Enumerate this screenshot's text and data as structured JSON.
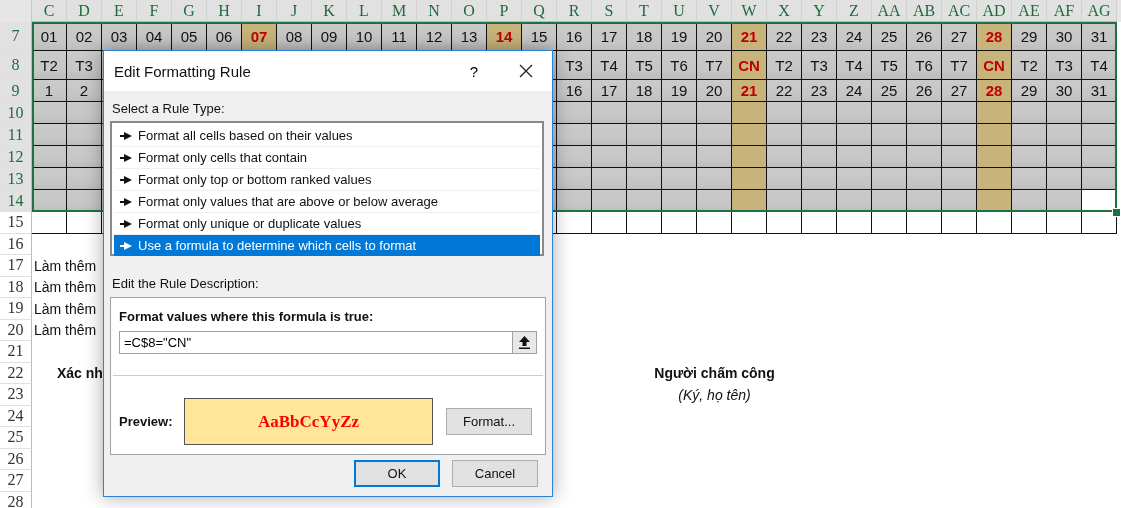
{
  "grid": {
    "columns": [
      {
        "label": "C",
        "selected": true
      },
      {
        "label": "D",
        "selected": true
      },
      {
        "label": "E",
        "selected": true
      },
      {
        "label": "F",
        "selected": true
      },
      {
        "label": "G",
        "selected": true
      },
      {
        "label": "H",
        "selected": true
      },
      {
        "label": "I",
        "selected": true
      },
      {
        "label": "J",
        "selected": true
      },
      {
        "label": "K",
        "selected": true
      },
      {
        "label": "L",
        "selected": true
      },
      {
        "label": "M",
        "selected": true
      },
      {
        "label": "N",
        "selected": true
      },
      {
        "label": "O",
        "selected": true
      },
      {
        "label": "P",
        "selected": true
      },
      {
        "label": "Q",
        "selected": true
      },
      {
        "label": "R",
        "selected": true
      },
      {
        "label": "S",
        "selected": true
      },
      {
        "label": "T",
        "selected": true
      },
      {
        "label": "U",
        "selected": true
      },
      {
        "label": "V",
        "selected": true
      },
      {
        "label": "W",
        "selected": true
      },
      {
        "label": "X",
        "selected": true
      },
      {
        "label": "Y",
        "selected": true
      },
      {
        "label": "Z",
        "selected": true
      },
      {
        "label": "AA",
        "selected": true
      },
      {
        "label": "AB",
        "selected": true
      },
      {
        "label": "AC",
        "selected": true
      },
      {
        "label": "AD",
        "selected": true
      },
      {
        "label": "AE",
        "selected": true
      },
      {
        "label": "AF",
        "selected": true
      },
      {
        "label": "AG",
        "selected": true
      }
    ],
    "rows": [
      {
        "header": "7",
        "selected": true,
        "kind": "full",
        "cells": [
          {
            "text": "01",
            "kind": "weekday"
          },
          {
            "text": "02",
            "kind": "weekday"
          },
          {
            "text": "03",
            "kind": "weekday"
          },
          {
            "text": "04",
            "kind": "weekday"
          },
          {
            "text": "05",
            "kind": "weekday"
          },
          {
            "text": "06",
            "kind": "weekday"
          },
          {
            "text": "07",
            "kind": "sunday"
          },
          {
            "text": "08",
            "kind": "weekday"
          },
          {
            "text": "09",
            "kind": "weekday"
          },
          {
            "text": "10",
            "kind": "weekday"
          },
          {
            "text": "11",
            "kind": "weekday"
          },
          {
            "text": "12",
            "kind": "weekday"
          },
          {
            "text": "13",
            "kind": "weekday"
          },
          {
            "text": "14",
            "kind": "sunday"
          },
          {
            "text": "15",
            "kind": "weekday"
          },
          {
            "text": "16",
            "kind": "weekday"
          },
          {
            "text": "17",
            "kind": "weekday"
          },
          {
            "text": "18",
            "kind": "weekday"
          },
          {
            "text": "19",
            "kind": "weekday"
          },
          {
            "text": "20",
            "kind": "weekday"
          },
          {
            "text": "21",
            "kind": "sunday"
          },
          {
            "text": "22",
            "kind": "weekday"
          },
          {
            "text": "23",
            "kind": "weekday"
          },
          {
            "text": "24",
            "kind": "weekday"
          },
          {
            "text": "25",
            "kind": "weekday"
          },
          {
            "text": "26",
            "kind": "weekday"
          },
          {
            "text": "27",
            "kind": "weekday"
          },
          {
            "text": "28",
            "kind": "sunday"
          },
          {
            "text": "29",
            "kind": "weekday"
          },
          {
            "text": "30",
            "kind": "weekday"
          },
          {
            "text": "31",
            "kind": "weekday"
          }
        ]
      },
      {
        "header": "8",
        "selected": true,
        "kind": "split",
        "left": [
          {
            "text": "T2",
            "kind": "weekday"
          },
          {
            "text": "T3",
            "kind": "weekday"
          }
        ],
        "right": [
          {
            "text": "T3",
            "kind": "weekday"
          },
          {
            "text": "T4",
            "kind": "weekday"
          },
          {
            "text": "T5",
            "kind": "weekday"
          },
          {
            "text": "T6",
            "kind": "weekday"
          },
          {
            "text": "T7",
            "kind": "weekday"
          },
          {
            "text": "CN",
            "kind": "sunday"
          },
          {
            "text": "T2",
            "kind": "weekday"
          },
          {
            "text": "T3",
            "kind": "weekday"
          },
          {
            "text": "T4",
            "kind": "weekday"
          },
          {
            "text": "T5",
            "kind": "weekday"
          },
          {
            "text": "T6",
            "kind": "weekday"
          },
          {
            "text": "T7",
            "kind": "weekday"
          },
          {
            "text": "CN",
            "kind": "sunday"
          },
          {
            "text": "T2",
            "kind": "weekday"
          },
          {
            "text": "T3",
            "kind": "weekday"
          },
          {
            "text": "T4",
            "kind": "weekday"
          }
        ]
      },
      {
        "header": "9",
        "selected": true,
        "kind": "split",
        "left": [
          {
            "text": "1",
            "kind": "weekday"
          },
          {
            "text": "2",
            "kind": "weekday"
          }
        ],
        "right": [
          {
            "text": "16",
            "kind": "weekday"
          },
          {
            "text": "17",
            "kind": "weekday"
          },
          {
            "text": "18",
            "kind": "weekday"
          },
          {
            "text": "19",
            "kind": "weekday"
          },
          {
            "text": "20",
            "kind": "weekday"
          },
          {
            "text": "21",
            "kind": "sunday"
          },
          {
            "text": "22",
            "kind": "weekday"
          },
          {
            "text": "23",
            "kind": "weekday"
          },
          {
            "text": "24",
            "kind": "weekday"
          },
          {
            "text": "25",
            "kind": "weekday"
          },
          {
            "text": "26",
            "kind": "weekday"
          },
          {
            "text": "27",
            "kind": "weekday"
          },
          {
            "text": "28",
            "kind": "sunday"
          },
          {
            "text": "29",
            "kind": "weekday"
          },
          {
            "text": "30",
            "kind": "weekday"
          },
          {
            "text": "31",
            "kind": "weekday"
          }
        ]
      },
      {
        "header": "10",
        "selected": true,
        "kind": "split",
        "left": [
          {
            "kind": "weekday"
          },
          {
            "kind": "weekday"
          }
        ],
        "right": [
          {
            "kind": "weekday"
          },
          {
            "kind": "weekday"
          },
          {
            "kind": "weekday"
          },
          {
            "kind": "weekday"
          },
          {
            "kind": "weekday"
          },
          {
            "kind": "sunday"
          },
          {
            "kind": "weekday"
          },
          {
            "kind": "weekday"
          },
          {
            "kind": "weekday"
          },
          {
            "kind": "weekday"
          },
          {
            "kind": "weekday"
          },
          {
            "kind": "weekday"
          },
          {
            "kind": "sunday"
          },
          {
            "kind": "weekday"
          },
          {
            "kind": "weekday"
          },
          {
            "kind": "weekday"
          }
        ]
      },
      {
        "header": "11",
        "selected": true,
        "kind": "split",
        "left": [
          {
            "kind": "weekday"
          },
          {
            "kind": "weekday"
          }
        ],
        "right": [
          {
            "kind": "weekday"
          },
          {
            "kind": "weekday"
          },
          {
            "kind": "weekday"
          },
          {
            "kind": "weekday"
          },
          {
            "kind": "weekday"
          },
          {
            "kind": "sunday"
          },
          {
            "kind": "weekday"
          },
          {
            "kind": "weekday"
          },
          {
            "kind": "weekday"
          },
          {
            "kind": "weekday"
          },
          {
            "kind": "weekday"
          },
          {
            "kind": "weekday"
          },
          {
            "kind": "sunday"
          },
          {
            "kind": "weekday"
          },
          {
            "kind": "weekday"
          },
          {
            "kind": "weekday"
          }
        ]
      },
      {
        "header": "12",
        "selected": true,
        "kind": "split",
        "left": [
          {
            "kind": "weekday"
          },
          {
            "kind": "weekday"
          }
        ],
        "right": [
          {
            "kind": "weekday"
          },
          {
            "kind": "weekday"
          },
          {
            "kind": "weekday"
          },
          {
            "kind": "weekday"
          },
          {
            "kind": "weekday"
          },
          {
            "kind": "sunday"
          },
          {
            "kind": "weekday"
          },
          {
            "kind": "weekday"
          },
          {
            "kind": "weekday"
          },
          {
            "kind": "weekday"
          },
          {
            "kind": "weekday"
          },
          {
            "kind": "weekday"
          },
          {
            "kind": "sunday"
          },
          {
            "kind": "weekday"
          },
          {
            "kind": "weekday"
          },
          {
            "kind": "weekday"
          }
        ]
      },
      {
        "header": "13",
        "selected": true,
        "kind": "split",
        "left": [
          {
            "kind": "weekday"
          },
          {
            "kind": "weekday"
          }
        ],
        "right": [
          {
            "kind": "weekday"
          },
          {
            "kind": "weekday"
          },
          {
            "kind": "weekday"
          },
          {
            "kind": "weekday"
          },
          {
            "kind": "weekday"
          },
          {
            "kind": "sunday"
          },
          {
            "kind": "weekday"
          },
          {
            "kind": "weekday"
          },
          {
            "kind": "weekday"
          },
          {
            "kind": "weekday"
          },
          {
            "kind": "weekday"
          },
          {
            "kind": "weekday"
          },
          {
            "kind": "sunday"
          },
          {
            "kind": "weekday"
          },
          {
            "kind": "weekday"
          },
          {
            "kind": "weekday"
          }
        ]
      },
      {
        "header": "14",
        "selected": true,
        "kind": "split",
        "left": [
          {
            "kind": "weekday"
          },
          {
            "kind": "weekday"
          }
        ],
        "right": [
          {
            "kind": "weekday"
          },
          {
            "kind": "weekday"
          },
          {
            "kind": "weekday"
          },
          {
            "kind": "weekday"
          },
          {
            "kind": "weekday"
          },
          {
            "kind": "sunday"
          },
          {
            "kind": "weekday"
          },
          {
            "kind": "weekday"
          },
          {
            "kind": "weekday"
          },
          {
            "kind": "weekday"
          },
          {
            "kind": "weekday"
          },
          {
            "kind": "weekday"
          },
          {
            "kind": "sunday"
          },
          {
            "kind": "weekday"
          },
          {
            "kind": "weekday"
          },
          {
            "kind": "empty"
          }
        ]
      },
      {
        "header": "15",
        "selected": false,
        "kind": "bordered"
      },
      {
        "header": "16",
        "selected": false,
        "kind": "text"
      },
      {
        "header": "17",
        "selected": false,
        "kind": "text",
        "texts": [
          {
            "text": "Làm thêm",
            "kind": "note"
          }
        ]
      },
      {
        "header": "18",
        "selected": false,
        "kind": "text",
        "texts": [
          {
            "text": "Làm thêm",
            "kind": "note"
          }
        ]
      },
      {
        "header": "19",
        "selected": false,
        "kind": "text",
        "texts": [
          {
            "text": "Làm thêm",
            "kind": "note"
          }
        ]
      },
      {
        "header": "20",
        "selected": false,
        "kind": "text",
        "texts": [
          {
            "text": "Làm thêm",
            "kind": "note"
          }
        ]
      },
      {
        "header": "21",
        "selected": false,
        "kind": "text"
      },
      {
        "header": "22",
        "selected": false,
        "kind": "text",
        "texts": [
          {
            "text": "Xác nh",
            "kind": "heading"
          },
          {
            "text": "Người chấm công",
            "kind": "signer"
          }
        ]
      },
      {
        "header": "23",
        "selected": false,
        "kind": "text",
        "texts": [
          {
            "text": "(Ký, họ tên)",
            "kind": "caption"
          }
        ]
      },
      {
        "header": "24",
        "selected": false,
        "kind": "text"
      },
      {
        "header": "25",
        "selected": false,
        "kind": "text"
      },
      {
        "header": "26",
        "selected": false,
        "kind": "text"
      },
      {
        "header": "27",
        "selected": false,
        "kind": "text"
      },
      {
        "header": "28",
        "selected": false,
        "kind": "text"
      }
    ]
  },
  "dialog": {
    "title": "Edit Formatting Rule",
    "help": "?",
    "rule_type_label": "Select a Rule Type:",
    "rule_types": [
      {
        "label": "Format all cells based on their values",
        "selected": false
      },
      {
        "label": "Format only cells that contain",
        "selected": false
      },
      {
        "label": "Format only top or bottom ranked values",
        "selected": false
      },
      {
        "label": "Format only values that are above or below average",
        "selected": false
      },
      {
        "label": "Format only unique or duplicate values",
        "selected": false
      },
      {
        "label": "Use a formula to determine which cells to format",
        "selected": true
      }
    ],
    "description_label": "Edit the Rule Description:",
    "formula_label": "Format values where this formula is true:",
    "formula": "=C$8=\"CN\"",
    "preview_label": "Preview:",
    "preview_sample": "AaBbCcYyZz",
    "format_button": "Format...",
    "ok_button": "OK",
    "cancel_button": "Cancel"
  }
}
